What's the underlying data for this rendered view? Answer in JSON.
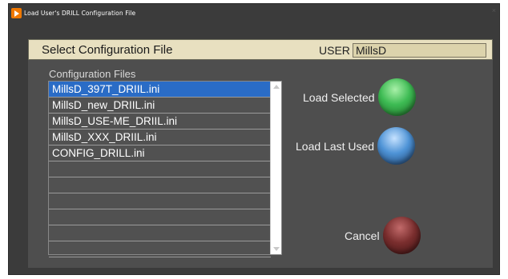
{
  "window": {
    "title": "Load User's DRILL Configuration File",
    "close_glyph": "×"
  },
  "header": {
    "title": "Select Configuration File",
    "user_label": "USER",
    "user_value": "MillsD"
  },
  "file_list": {
    "label": "Configuration Files",
    "items": [
      {
        "label": "MillsD_397T_DRIIL.ini",
        "selected": true
      },
      {
        "label": "MillsD_new_DRIIL.ini",
        "selected": false
      },
      {
        "label": "MillsD_USE-ME_DRIIL.ini",
        "selected": false
      },
      {
        "label": "MillsD_XXX_DRIIL.ini",
        "selected": false
      },
      {
        "label": "CONFIG_DRILL.ini",
        "selected": false
      },
      {
        "label": "",
        "selected": false
      },
      {
        "label": "",
        "selected": false
      },
      {
        "label": "",
        "selected": false
      },
      {
        "label": "",
        "selected": false
      },
      {
        "label": "",
        "selected": false
      },
      {
        "label": "",
        "selected": false
      }
    ]
  },
  "actions": {
    "load_selected": "Load Selected",
    "load_last_used": "Load Last Used",
    "cancel": "Cancel"
  },
  "colors": {
    "accent_selected": "#2a6cc6",
    "header_bar": "#e8e0c0",
    "load_selected_orb": "#3dbb53",
    "load_last_used_orb": "#4e93d6",
    "cancel_orb": "#7a2e2e"
  }
}
